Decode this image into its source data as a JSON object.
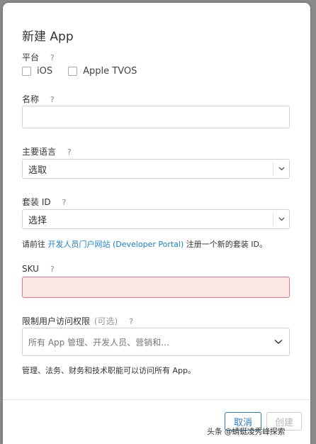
{
  "dialog": {
    "title": "新建 App",
    "help_glyph": "?",
    "platform": {
      "label": "平台",
      "options": [
        {
          "label": "iOS",
          "checked": false
        },
        {
          "label": "Apple TVOS",
          "checked": false
        }
      ]
    },
    "name": {
      "label": "名称",
      "value": ""
    },
    "language": {
      "label": "主要语言",
      "selected": "选取"
    },
    "bundle": {
      "label": "套装 ID",
      "selected": "选择",
      "hint_prefix": "请前往 ",
      "hint_link": "开发人员门户网站 (Developer Portal)",
      "hint_suffix": " 注册一个新的套装 ID。"
    },
    "sku": {
      "label": "SKU",
      "value": ""
    },
    "access": {
      "label": "限制用户访问权限",
      "optional": "(可选)",
      "placeholder": "所有 App 管理、开发人员、营销和…",
      "note": "管理、法务、财务和技术职能可以访问所有 App。"
    },
    "buttons": {
      "cancel": "取消",
      "create": "创建"
    }
  },
  "watermark": "头条 @蜻蜓凌秀峰探索",
  "colors": {
    "link": "#1a82c8",
    "error_bg": "#fde6e6",
    "error_border": "#e37b7b",
    "primary": "#2a7ec4"
  }
}
